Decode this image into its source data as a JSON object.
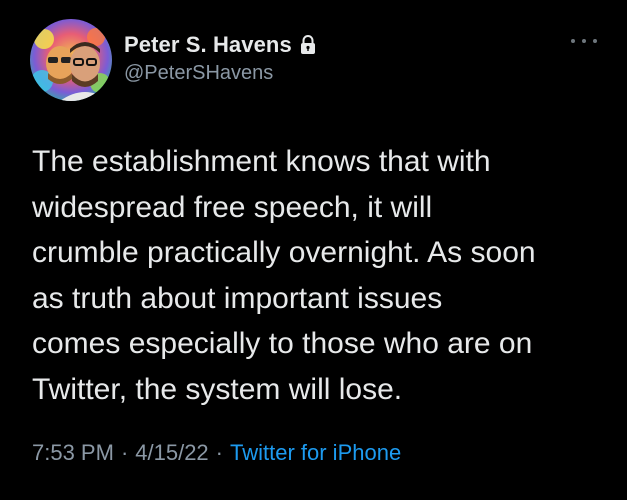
{
  "user": {
    "display_name": "Peter S. Havens",
    "handle": "@PeterSHavens",
    "protected_icon": "lock-icon",
    "avatar": "avatar"
  },
  "tweet": {
    "text": "The establishment knows that with\nwidespread free speech, it will\ncrumble practically overnight. As soon\nas truth about important issues\ncomes especially to those who are on\nTwitter, the system will lose.",
    "time": "7:53 PM",
    "separator": "·",
    "date": "4/15/22",
    "source": "Twitter for iPhone"
  },
  "menu": {
    "icon": "more-icon"
  },
  "colors": {
    "background": "#000000",
    "text": "#e7e9ea",
    "secondary_text": "#8b98a5",
    "link": "#1d9bf0"
  }
}
